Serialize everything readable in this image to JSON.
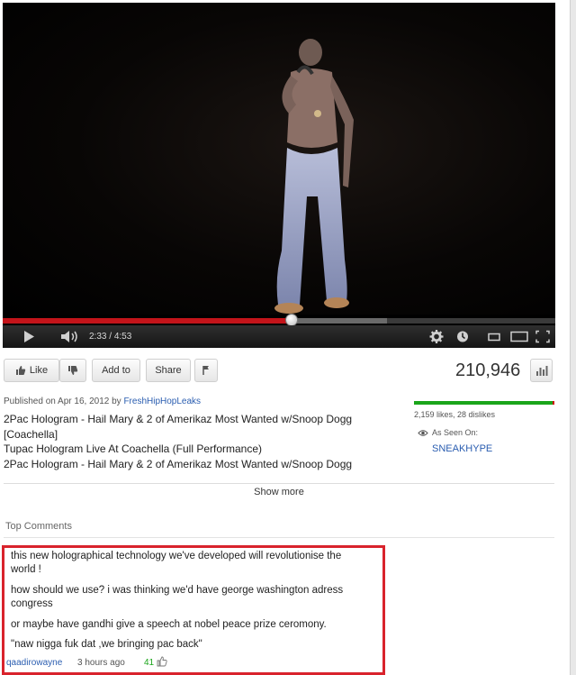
{
  "player": {
    "current_time": "2:33",
    "duration": "4:53",
    "time_separator": "/",
    "progress_fraction": 0.522,
    "buffered_fraction": 0.695,
    "icons": [
      "play-icon",
      "volume-icon",
      "gear-icon",
      "annotation-icon",
      "small-player-icon",
      "large-player-icon",
      "fullscreen-icon"
    ]
  },
  "actions": {
    "like_label": "Like",
    "add_to_label": "Add to",
    "share_label": "Share",
    "view_count": "210,946"
  },
  "details": {
    "published_prefix": "Published on Apr 16, 2012 by",
    "channel": "FreshHipHopLeaks",
    "description_lines": [
      "2Pac Hologram - Hail Mary & 2 of Amerikaz Most Wanted w/Snoop Dogg",
      "[Coachella]",
      "Tupac Hologram Live At Coachella (Full Performance)",
      "2Pac Hologram - Hail Mary & 2 of Amerikaz Most Wanted w/Snoop Dogg"
    ],
    "likes_text": "2,159 likes, 28 dislikes",
    "like_ratio": 0.987,
    "seen_on_label": "As Seen On:",
    "seen_on_link": "SNEAKHYPE",
    "show_more": "Show more"
  },
  "comments": {
    "header": "Top Comments",
    "lines": [
      "this new holographical technology we've developed will revolutionise the",
      "world !",
      "how should we use? i was thinking we'd have george washington adress",
      "congress",
      "or maybe have gandhi give a speech at nobel peace prize ceromony.",
      "\"naw nigga fuk dat ,we bringing pac back\""
    ],
    "author": "qaadirowayne",
    "time_ago": "3 hours ago",
    "vote_count": "41"
  },
  "colors": {
    "progress_red": "#c4141a",
    "link_blue": "#2a5db0",
    "highlight_red": "#d9232c",
    "like_green": "#1aa51a"
  }
}
